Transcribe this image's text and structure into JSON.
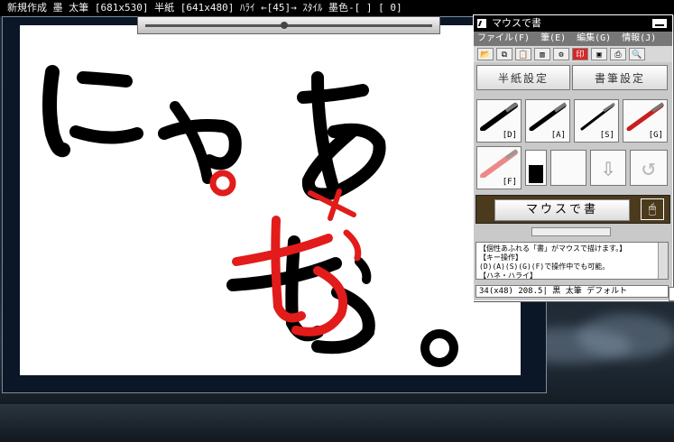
{
  "top_status": "新規作成 墨 太筆 [681x530] 半紙 [641x480] ﾊﾗｲ ←[45]→ ｽﾀｲﾙ 墨色-[ ] [ 0]",
  "canvas_text": {
    "main": "にゃあ",
    "correction": "お",
    "period": "。",
    "mark": "×"
  },
  "colors": {
    "ink": "#000000",
    "correction": "#e21b1b",
    "palette_bg": "#c9c9c9"
  },
  "palette": {
    "title": "マウスで書",
    "menu": [
      "ファイル(F)",
      "筆(E)",
      "編集(G)",
      "情報(J)"
    ],
    "toolbar_icons": [
      "open-folder-icon",
      "copy-icon",
      "paste-icon",
      "brush-settings-icon",
      "rotate-icon",
      "red-mark-icon",
      "frame-icon",
      "print-icon",
      "search-icon"
    ],
    "toolbar_glyphs": [
      "📂",
      "⧉",
      "📋",
      "▥",
      "⚙",
      "印",
      "▣",
      "⎙",
      "🔍"
    ],
    "paper_settings": "半紙設定",
    "brush_settings": "書筆設定",
    "brushes": [
      {
        "label": "[D]",
        "color": "#000000"
      },
      {
        "label": "[A]",
        "color": "#000000"
      },
      {
        "label": "[S]",
        "color": "#000000"
      },
      {
        "label": "[G]",
        "color": "#c81e1e"
      },
      {
        "label": "[F]",
        "color": "#c81e1e"
      }
    ],
    "logo": "マウスで書",
    "help_lines": [
      "【個性あふれる「書」がマウスで描けます。】",
      "【キー操作】",
      "(D)(A)(S)(G)(F)で操作中でも可能。",
      "【ハネ・ハライ】"
    ],
    "status": "34(x48) 208.5| 黒 太筆 デフォルト"
  }
}
